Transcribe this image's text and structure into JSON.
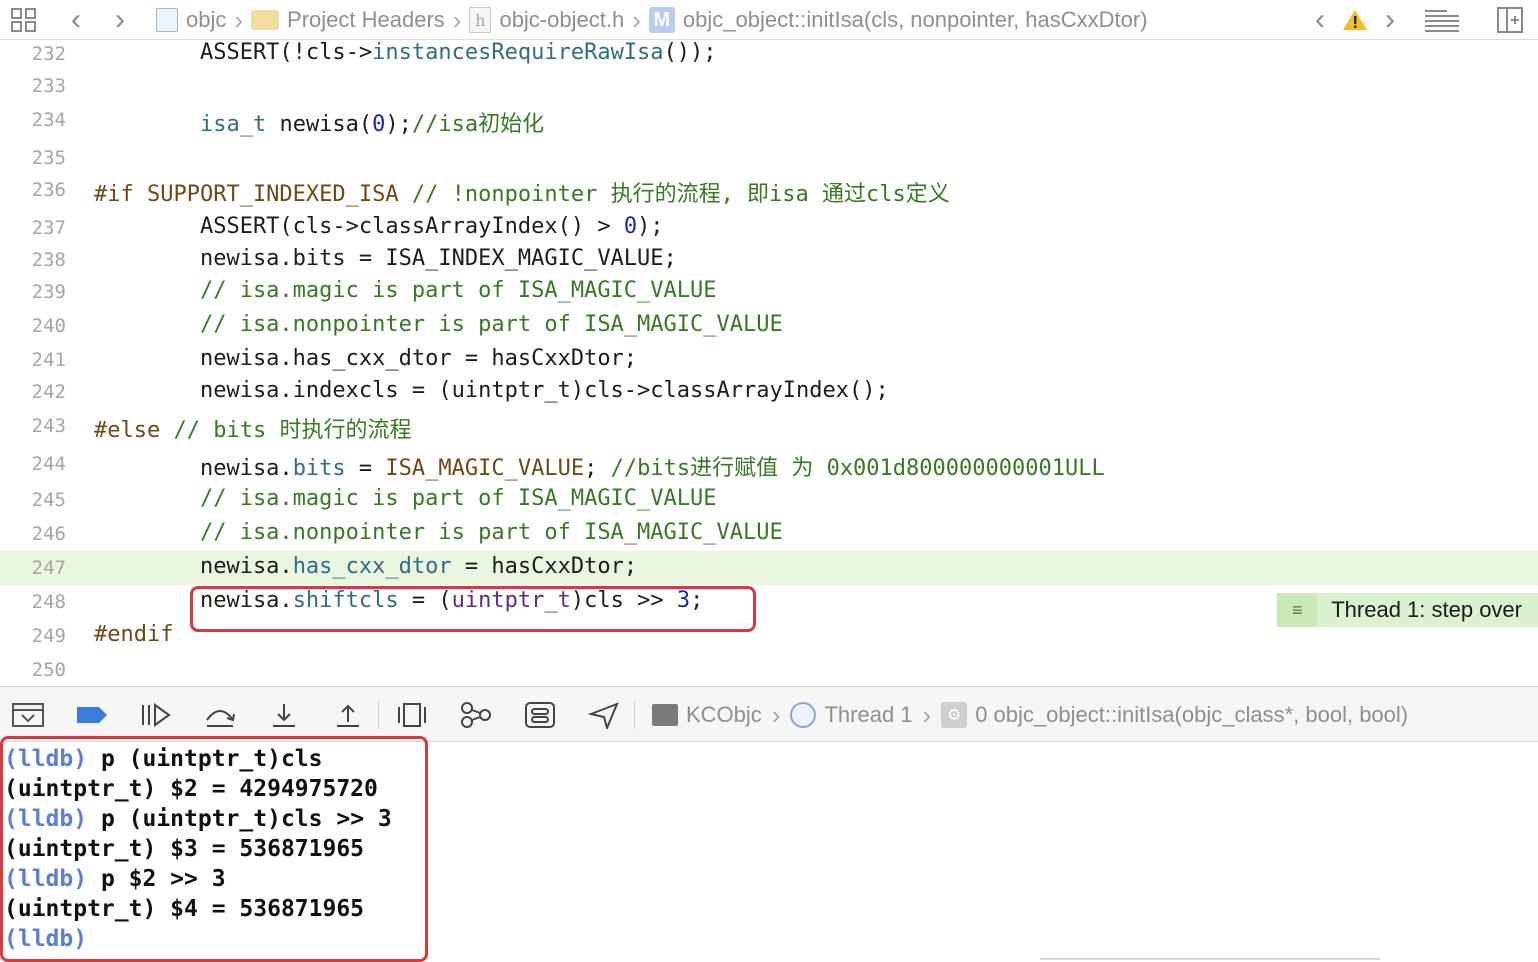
{
  "jumpbar": {
    "crumbs": [
      {
        "icon": "project-icon",
        "label": "objc"
      },
      {
        "icon": "folder-icon",
        "label": "Project Headers"
      },
      {
        "icon": "header-file-icon",
        "label": "objc-object.h"
      },
      {
        "icon": "method-icon",
        "label": "objc_object::initIsa(cls, nonpointer, hasCxxDtor)"
      }
    ],
    "header_glyph": "h",
    "method_glyph": "M"
  },
  "editor": {
    "lines": [
      {
        "num": "232",
        "tokens": [
          {
            "t": "        ASSERT(!cls->",
            "c": "plain"
          },
          {
            "t": "instancesRequireRawIsa",
            "c": "prop"
          },
          {
            "t": "());",
            "c": "plain"
          }
        ]
      },
      {
        "num": "233",
        "tokens": []
      },
      {
        "num": "234",
        "tokens": [
          {
            "t": "        ",
            "c": "plain"
          },
          {
            "t": "isa_t",
            "c": "prop"
          },
          {
            "t": " newisa(",
            "c": "plain"
          },
          {
            "t": "0",
            "c": "num"
          },
          {
            "t": ");",
            "c": "plain"
          },
          {
            "t": "//isa初始化",
            "c": "com"
          }
        ]
      },
      {
        "num": "235",
        "tokens": []
      },
      {
        "num": "236",
        "tokens": [
          {
            "t": "#if SUPPORT_INDEXED_ISA ",
            "c": "pre"
          },
          {
            "t": "// !nonpointer 执行的流程, 即isa 通过cls定义",
            "c": "com"
          }
        ]
      },
      {
        "num": "237",
        "tokens": [
          {
            "t": "        ASSERT(cls->classArrayIndex() > ",
            "c": "plain"
          },
          {
            "t": "0",
            "c": "num"
          },
          {
            "t": ");",
            "c": "plain"
          }
        ]
      },
      {
        "num": "238",
        "tokens": [
          {
            "t": "        newisa.bits = ISA_INDEX_MAGIC_VALUE;",
            "c": "plain"
          }
        ]
      },
      {
        "num": "239",
        "tokens": [
          {
            "t": "        // isa.magic is part of ISA_MAGIC_VALUE",
            "c": "com"
          }
        ]
      },
      {
        "num": "240",
        "tokens": [
          {
            "t": "        // isa.nonpointer is part of ISA_MAGIC_VALUE",
            "c": "com"
          }
        ]
      },
      {
        "num": "241",
        "tokens": [
          {
            "t": "        newisa.has_cxx_dtor = hasCxxDtor;",
            "c": "plain"
          }
        ]
      },
      {
        "num": "242",
        "tokens": [
          {
            "t": "        newisa.indexcls = (uintptr_t)cls->classArrayIndex();",
            "c": "plain"
          }
        ]
      },
      {
        "num": "243",
        "tokens": [
          {
            "t": "#else ",
            "c": "pre"
          },
          {
            "t": "// bits 时执行的流程",
            "c": "com"
          }
        ]
      },
      {
        "num": "244",
        "tokens": [
          {
            "t": "        newisa.",
            "c": "plain"
          },
          {
            "t": "bits",
            "c": "prop"
          },
          {
            "t": " = ",
            "c": "plain"
          },
          {
            "t": "ISA_MAGIC_VALUE",
            "c": "pre"
          },
          {
            "t": "; ",
            "c": "plain"
          },
          {
            "t": "//bits进行赋值 为 0x001d800000000001ULL",
            "c": "com"
          }
        ]
      },
      {
        "num": "245",
        "tokens": [
          {
            "t": "        // isa.magic is part of ISA_MAGIC_VALUE",
            "c": "com"
          }
        ]
      },
      {
        "num": "246",
        "tokens": [
          {
            "t": "        // isa.nonpointer is part of ISA_MAGIC_VALUE",
            "c": "com"
          }
        ]
      },
      {
        "num": "247",
        "tokens": [
          {
            "t": "        newisa.",
            "c": "plain"
          },
          {
            "t": "has_cxx_dtor",
            "c": "prop"
          },
          {
            "t": " = hasCxxDtor;",
            "c": "plain"
          }
        ]
      },
      {
        "num": "248",
        "tokens": [
          {
            "t": "        newisa.",
            "c": "plain"
          },
          {
            "t": "shiftcls",
            "c": "prop"
          },
          {
            "t": " = (",
            "c": "plain"
          },
          {
            "t": "uintptr_t",
            "c": "type"
          },
          {
            "t": ")cls >> ",
            "c": "plain"
          },
          {
            "t": "3",
            "c": "num"
          },
          {
            "t": ";",
            "c": "plain"
          }
        ]
      },
      {
        "num": "249",
        "tokens": [
          {
            "t": "#endif",
            "c": "pre"
          }
        ]
      },
      {
        "num": "250",
        "tokens": []
      }
    ],
    "current_line": "247",
    "thread_badge": "Thread 1: step over",
    "badge_icon": "≡"
  },
  "debugbar": {
    "process": "KCObjc",
    "thread": "Thread 1",
    "frame": "0 objc_object::initIsa(objc_class*, bool, bool)"
  },
  "console": {
    "lines": [
      {
        "prompt": "(lldb)",
        "text": " p (uintptr_t)cls"
      },
      {
        "prompt": "",
        "text": "(uintptr_t) $2 = 4294975720"
      },
      {
        "prompt": "(lldb)",
        "text": " p (uintptr_t)cls >> 3"
      },
      {
        "prompt": "",
        "text": "(uintptr_t) $3 = 536871965"
      },
      {
        "prompt": "(lldb)",
        "text": " p $2 >> 3"
      },
      {
        "prompt": "",
        "text": "(uintptr_t) $4 = 536871965"
      },
      {
        "prompt": "(lldb)",
        "text": ""
      }
    ]
  },
  "colors": {
    "preprocessor": "#6d4a14",
    "comment": "#377a23",
    "number": "#1c24b8",
    "type": "#5b2d8e",
    "property": "#2f6f80",
    "current_line_bg": "#e9f6e0",
    "highlight_box": "#d9383f",
    "lldb_prompt": "#5b7fd9"
  }
}
